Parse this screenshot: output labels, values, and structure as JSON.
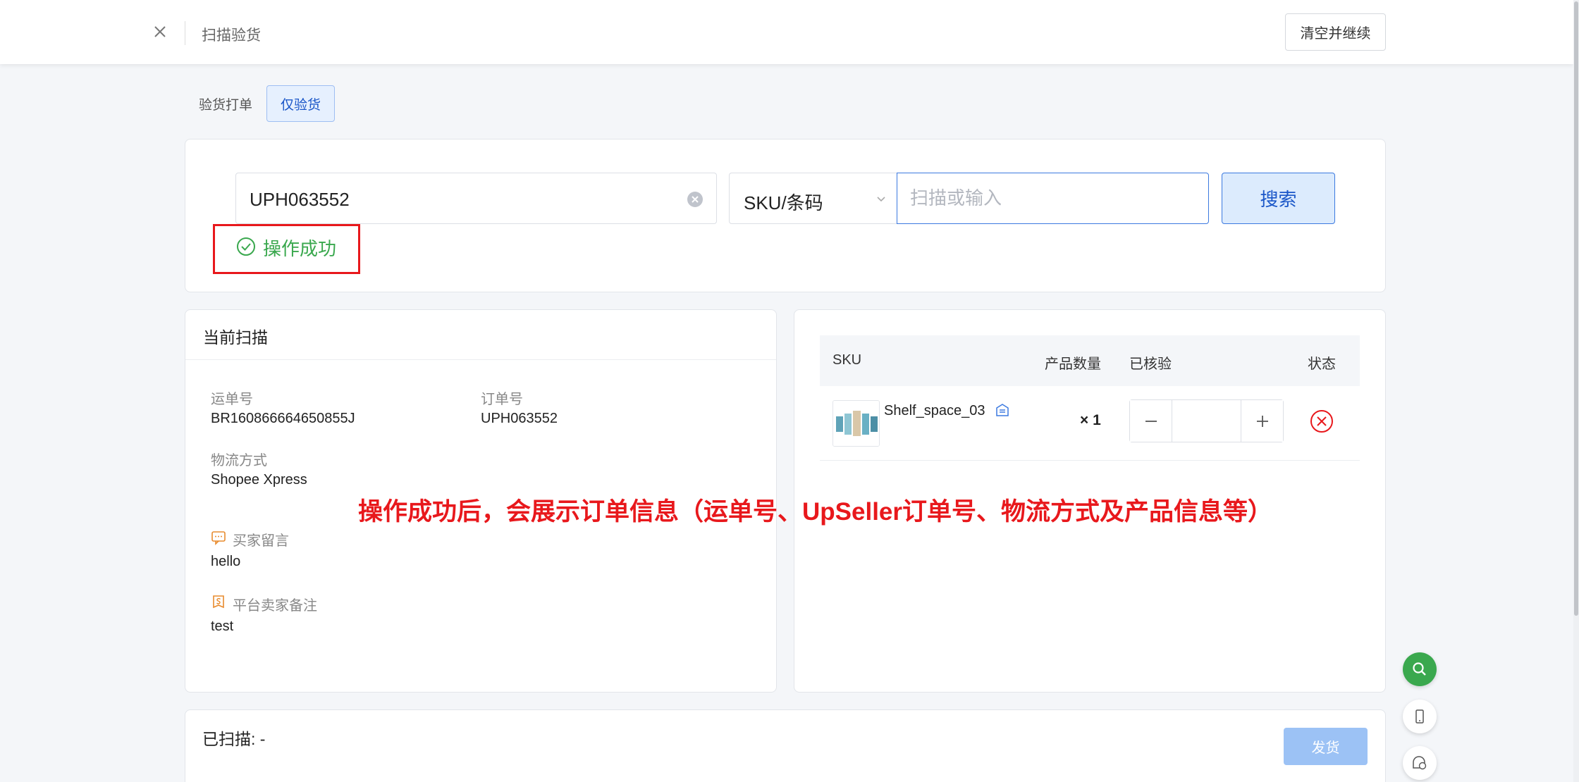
{
  "header": {
    "title": "扫描验货",
    "clear_continue_label": "清空并继续"
  },
  "mode_tabs": [
    "验货打单",
    "仅验货"
  ],
  "search": {
    "order_value": "UPH063552",
    "type_select": "SKU/条码",
    "scan_placeholder": "扫描或输入",
    "search_label": "搜索",
    "status_message": "操作成功"
  },
  "current_scan": {
    "title": "当前扫描",
    "waybill_label": "运单号",
    "waybill_value": "BR160866664650855J",
    "order_label": "订单号",
    "order_value": "UPH063552",
    "logistics_label": "物流方式",
    "logistics_value": "Shopee Xpress",
    "buyer_note_label": "买家留言",
    "buyer_note_value": "hello",
    "seller_note_label": "平台卖家备注",
    "seller_note_value": "test"
  },
  "sku_table": {
    "columns": [
      "SKU",
      "产品数量",
      "已核验",
      "状态"
    ],
    "rows": [
      {
        "sku": "Shelf_space_03",
        "quantity": "× 1",
        "verified": ""
      }
    ]
  },
  "annotation": "操作成功后，会展示订单信息（运单号、UpSeller订单号、物流方式及产品信息等）",
  "bottom": {
    "scanned_label": "已扫描: -",
    "ship_label": "发货"
  },
  "colors": {
    "primary": "#3b79e0",
    "success": "#3aa84e",
    "annotation_red": "#e8181c"
  }
}
